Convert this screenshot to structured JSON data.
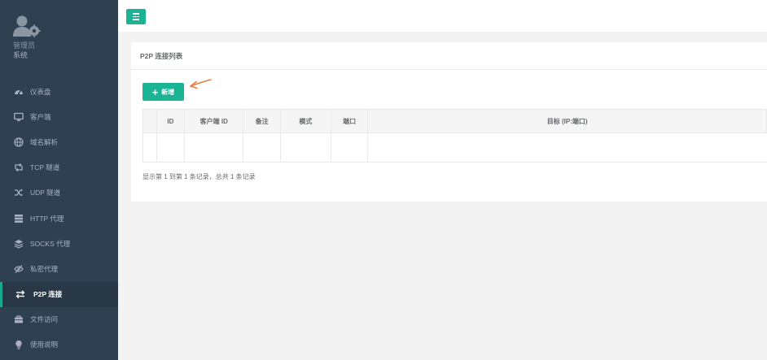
{
  "profile": {
    "role": "管理员",
    "system": "系统"
  },
  "nav": [
    {
      "label": "仪表盘",
      "icon": "dashboard-icon"
    },
    {
      "label": "客户端",
      "icon": "monitor-icon"
    },
    {
      "label": "域名解析",
      "icon": "globe-icon"
    },
    {
      "label": "TCP 隧道",
      "icon": "retweet-icon"
    },
    {
      "label": "UDP 隧道",
      "icon": "shuffle-icon"
    },
    {
      "label": "HTTP 代理",
      "icon": "server-icon"
    },
    {
      "label": "SOCKS 代理",
      "icon": "layers-icon"
    },
    {
      "label": "私密代理",
      "icon": "eye-slash-icon"
    },
    {
      "label": "P2P 连接",
      "icon": "exchange-icon",
      "active": true
    },
    {
      "label": "文件访问",
      "icon": "briefcase-icon"
    },
    {
      "label": "使用说明",
      "icon": "lightbulb-icon"
    }
  ],
  "panel": {
    "title": "P2P 连接列表",
    "add_label": "新增"
  },
  "table": {
    "headers": [
      "",
      "ID",
      "客户端 ID",
      "备注",
      "模式",
      "端口",
      "目标 (IP:端口)"
    ]
  },
  "footer": {
    "summary": "显示第 1 到第 1 条记录，总共 1 条记录"
  },
  "colors": {
    "sidebar": "#2f4050",
    "accent": "#1ab394",
    "arrow": "#f07a3c"
  }
}
